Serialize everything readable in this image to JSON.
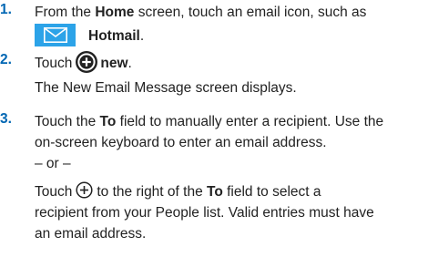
{
  "steps": [
    {
      "number": "1.",
      "line1_pre": "From the ",
      "line1_bold": "Home",
      "line1_post": " screen, touch an email icon, such as",
      "app_name": "Hotmail",
      "app_icon": "mail-tile-icon",
      "period": "."
    },
    {
      "number": "2.",
      "pre": "Touch",
      "icon": "new-circle-plus-icon",
      "bold": "new",
      "period": ".",
      "note": "The New Email Message screen displays."
    },
    {
      "number": "3.",
      "p1_pre": "Touch the ",
      "p1_bold": "To",
      "p1_line1_post": " field to manually enter a recipient. Use the",
      "p1_line2": "on-screen keyboard to enter an email address.",
      "or": "– or –",
      "p2_pre": "Touch",
      "p2_icon": "add-circle-icon",
      "p2_mid": "to the right of the ",
      "p2_bold": "To",
      "p2_line1_post": " field to select a",
      "p2_line2": "recipient from your People list. Valid entries must have",
      "p2_line3": "an email address."
    }
  ],
  "colors": {
    "step_number": "#0066b3",
    "mail_tile": "#2ca3e8"
  }
}
